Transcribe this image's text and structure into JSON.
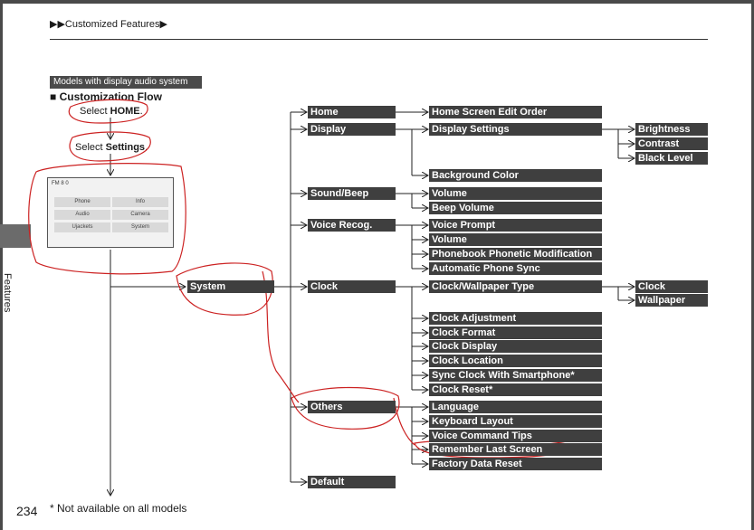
{
  "header": {
    "breadcrumb": "▶▶Customized Features▶"
  },
  "side_tab": {
    "label": "Features"
  },
  "models_label": "Models with display audio system",
  "flow_title": "■ Customization Flow",
  "steps": {
    "select_home_prefix": "Select ",
    "select_home_key": "HOME",
    "select_home_suffix": ".",
    "select_settings_prefix": "Select ",
    "select_settings_key": "Settings",
    "select_settings_suffix": "."
  },
  "screen": {
    "status": "FM 8 0",
    "buttons": [
      "Phone",
      "Info",
      "Audio",
      "Camera",
      "Ujackets",
      "System"
    ]
  },
  "system": "System",
  "level1": [
    "Home",
    "Display",
    "Sound/Beep",
    "Voice Recog.",
    "Clock",
    "Others",
    "Default"
  ],
  "home": [
    "Home Screen Edit Order"
  ],
  "display": [
    "Display Settings",
    "Background Color"
  ],
  "display_settings": [
    "Brightness",
    "Contrast",
    "Black Level"
  ],
  "sound": [
    "Volume",
    "Beep Volume"
  ],
  "voice": [
    "Voice Prompt",
    "Volume",
    "Phonebook Phonetic Modification",
    "Automatic Phone Sync"
  ],
  "clock": [
    "Clock/Wallpaper Type",
    "Clock Adjustment",
    "Clock Format",
    "Clock Display",
    "Clock Location",
    "Sync Clock With Smartphone*",
    "Clock Reset*"
  ],
  "clock_type": [
    "Clock",
    "Wallpaper"
  ],
  "others": [
    "Language",
    "Keyboard Layout",
    "Voice Command Tips",
    "Remember Last Screen",
    "Factory Data Reset"
  ],
  "footer": {
    "page": "234",
    "note": "* Not available on all models"
  }
}
